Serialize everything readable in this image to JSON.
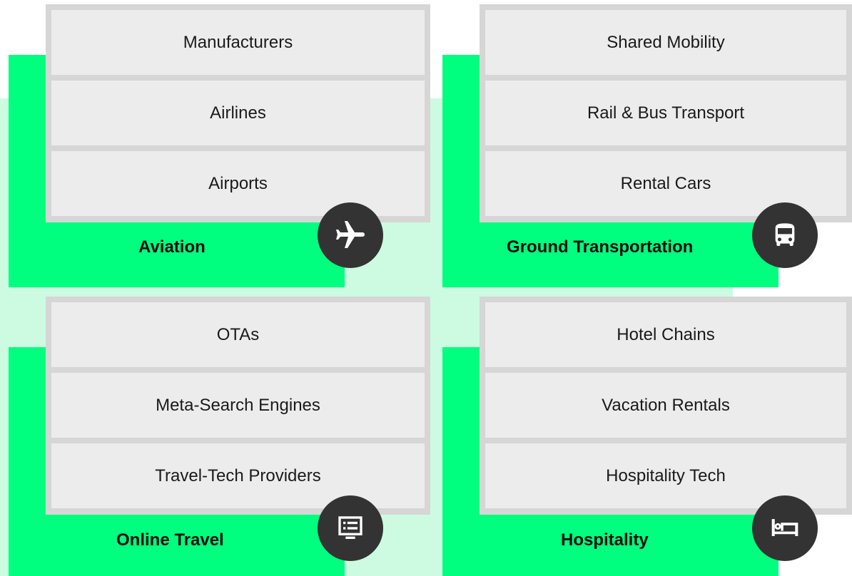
{
  "sections": [
    {
      "id": "aviation",
      "label": "Aviation",
      "icon": "airplane-icon",
      "items": [
        "Manufacturers",
        "Airlines",
        "Airports"
      ]
    },
    {
      "id": "ground-transportation",
      "label": "Ground Transportation",
      "icon": "bus-icon",
      "items": [
        "Shared Mobility",
        "Rail & Bus Transport",
        "Rental Cars"
      ]
    },
    {
      "id": "online-travel",
      "label": "Online Travel",
      "icon": "computer-monitor-icon",
      "items": [
        "OTAs",
        "Meta-Search Engines",
        "Travel-Tech Providers"
      ]
    },
    {
      "id": "hospitality",
      "label": "Hospitality",
      "icon": "bed-icon",
      "items": [
        "Hotel Chains",
        "Vacation Rentals",
        "Hospitality Tech"
      ]
    }
  ],
  "colors": {
    "accent_green": "#00ff7f",
    "mint_background": "#ccfbe2",
    "item_background": "#ececec",
    "item_border": "#d6d6d6",
    "badge": "#333333"
  }
}
